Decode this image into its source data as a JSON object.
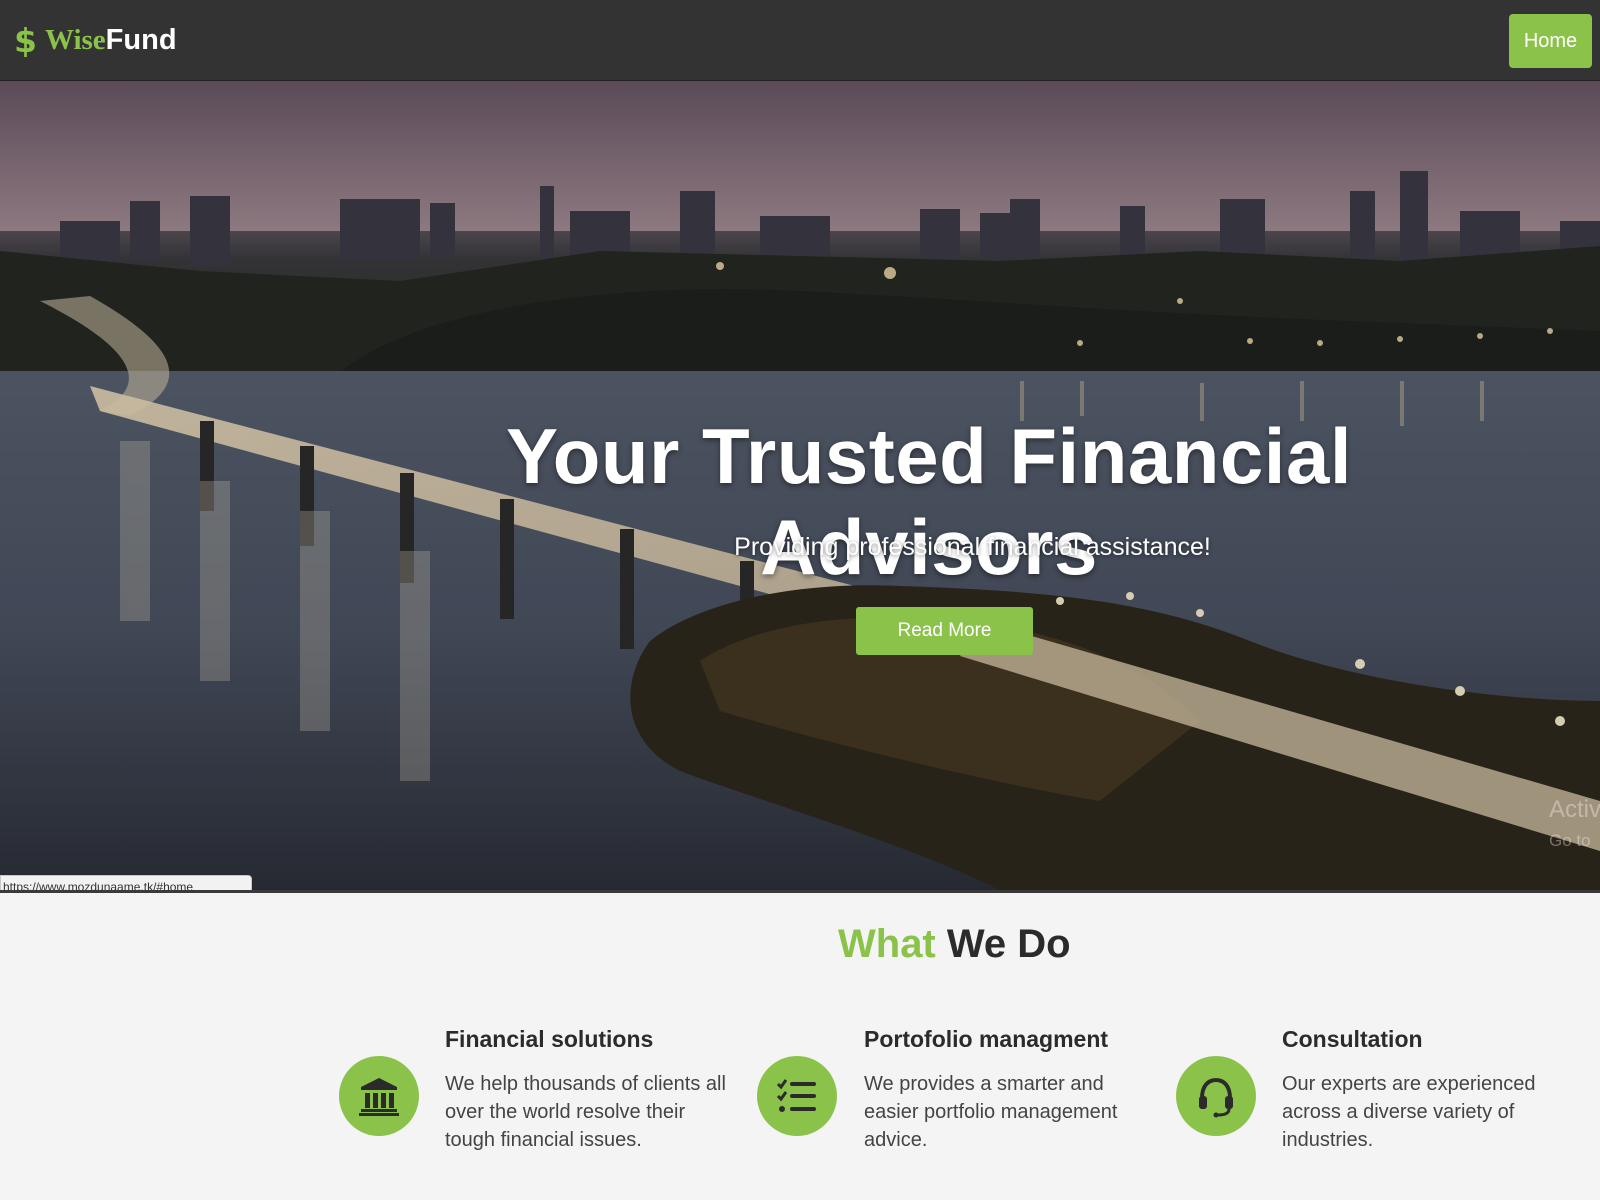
{
  "brand": {
    "symbol": "$",
    "part1": "Wise",
    "part2": "Fund"
  },
  "nav": {
    "home_label": "Home"
  },
  "hero": {
    "title": "Your Trusted Financial Advisors",
    "subtitle": "Providing professional financial assistance!",
    "cta_label": "Read More"
  },
  "status_bar": {
    "url": "https://www.mozdunaame.tk/#home"
  },
  "watermark": {
    "line1": "Activ",
    "line2": "Go to"
  },
  "what_we_do": {
    "title_green": "What",
    "title_dark": "We Do",
    "services": [
      {
        "icon": "bank-icon",
        "title": "Financial solutions",
        "text": "We help thousands of clients all over the world resolve their tough financial issues."
      },
      {
        "icon": "checklist-icon",
        "title": "Portofolio managment",
        "text": "We provides a smarter and easier portfolio management advice."
      },
      {
        "icon": "headset-icon",
        "title": "Consultation",
        "text": "Our experts are experienced across a diverse variety of industries."
      }
    ]
  },
  "colors": {
    "accent": "#8bc34a",
    "navbar": "#333333",
    "section_bg": "#f4f4f4"
  }
}
